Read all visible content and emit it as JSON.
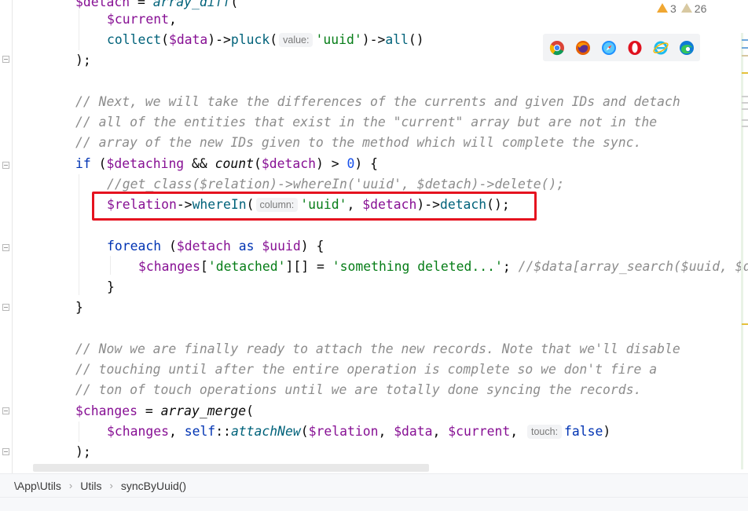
{
  "inspections": {
    "warnings": "3",
    "weak_warnings": "26"
  },
  "browsers": [
    {
      "name": "chrome-icon",
      "color": "#db4437"
    },
    {
      "name": "firefox-icon",
      "color": "#e66000"
    },
    {
      "name": "safari-icon",
      "color": "#1e90ff"
    },
    {
      "name": "opera-icon",
      "color": "#e0121f"
    },
    {
      "name": "ie-icon",
      "color": "#1ebbee"
    },
    {
      "name": "edge-icon",
      "color": "#0f7bd6"
    }
  ],
  "code": {
    "l1": {
      "var": "$detach",
      "rest": " = ",
      "fn": "array_diff",
      "paren": "("
    },
    "l2": {
      "var": "$current",
      "comma": ","
    },
    "l3": {
      "fn1": "collect",
      "p1": "(",
      "var": "$data",
      "p2": ")->",
      "fn2": "pluck",
      "p3": "(",
      "hint": "value:",
      "str": "'uuid'",
      "p4": ")->",
      "fn3": "all",
      "p5": "()"
    },
    "l4": ");",
    "c1": "// Next, we will take the differences of the currents and given IDs and detach",
    "c2": "// all of the entities that exist in the \"current\" array but are not in the",
    "c3": "// array of the new IDs given to the method which will complete the sync.",
    "l8": {
      "kw": "if",
      "p1": " (",
      "var1": "$detaching",
      "op": " && ",
      "fn": "count",
      "p2": "(",
      "var2": "$detach",
      "p3": ") > ",
      "num": "0",
      "p4": ") {"
    },
    "c4": "//get_class($relation)->whereIn('uuid', $detach)->delete();",
    "l10": {
      "var1": "$relation",
      "p1": "->",
      "fn1": "whereIn",
      "p2": "(",
      "hint": "column:",
      "str": "'uuid'",
      "p3": ", ",
      "var2": "$detach",
      "p4": ")->",
      "fn2": "detach",
      "p5": "();"
    },
    "l12": {
      "kw1": "foreach",
      "p1": " (",
      "var1": "$detach",
      "kw2": " as ",
      "var2": "$uuid",
      "p2": ") {"
    },
    "l13": {
      "var1": "$changes",
      "p1": "[",
      "str1": "'detached'",
      "p2": "][] = ",
      "str2": "'something deleted...'",
      "p3": "; ",
      "cm": "//$data[array_search($uuid, $d"
    },
    "l14": "}",
    "l15": "}",
    "c5": "// Now we are finally ready to attach the new records. Note that we'll disable",
    "c6": "// touching until after the entire operation is complete so we don't fire a",
    "c7": "// ton of touch operations until we are totally done syncing the records.",
    "l20": {
      "var": "$changes",
      "rest": " = ",
      "fn": "array_merge",
      "paren": "("
    },
    "l21": {
      "var1": "$changes",
      "p1": ", ",
      "kw": "self",
      "p2": "::",
      "fn": "attachNew",
      "p3": "(",
      "var2": "$relation",
      "p4": ", ",
      "var3": "$data",
      "p5": ", ",
      "var4": "$current",
      "p6": ", ",
      "hint": "touch:",
      "kw2": "false",
      "p7": ")"
    },
    "l22": ");"
  },
  "breadcrumb": {
    "namespace": "\\App\\Utils",
    "class": "Utils",
    "method": "syncByUuid()"
  }
}
